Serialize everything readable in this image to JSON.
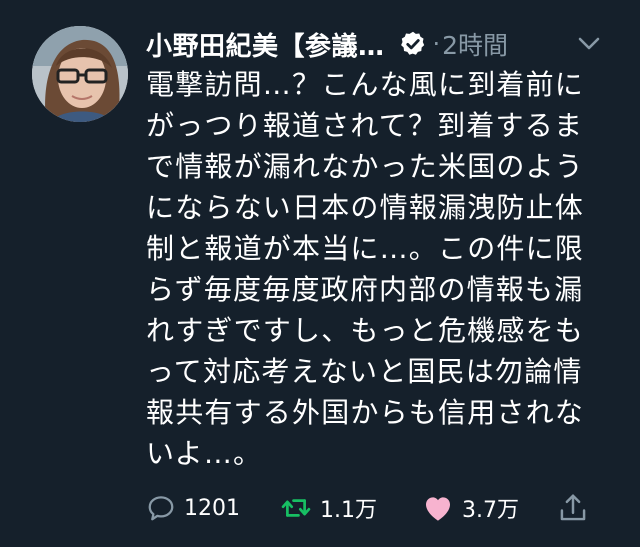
{
  "tweet": {
    "author_name": "小野田紀美【参議…",
    "separator": "·",
    "time": "2時間",
    "text_lines": [
      "電撃訪問…？こんな風に到着前に",
      "がっつり報道されて？到着するま",
      "で情報が漏れなかった米国のよう",
      "にならない日本の情報漏洩防止体",
      "制と報道が本当に…。この件に限",
      "らず毎度毎度政府内部の情報も漏",
      "れすぎですし、もっと危機感をも",
      "って対応考えないと国民は勿論情",
      "報共有する外国からも信用されな",
      "いよ…。"
    ]
  },
  "actions": {
    "reply_count": "1201",
    "retweet_count": "1.1万",
    "like_count": "3.7万"
  },
  "icons": {
    "verified": "verified-badge-icon",
    "menu": "chevron-down-icon",
    "reply": "reply-icon",
    "retweet": "retweet-icon",
    "like": "heart-icon",
    "share": "share-icon"
  },
  "colors": {
    "background": "#15202b",
    "secondary_text": "#8899a6",
    "retweet_green": "#17bf63",
    "like_pink": "#e0245e"
  }
}
